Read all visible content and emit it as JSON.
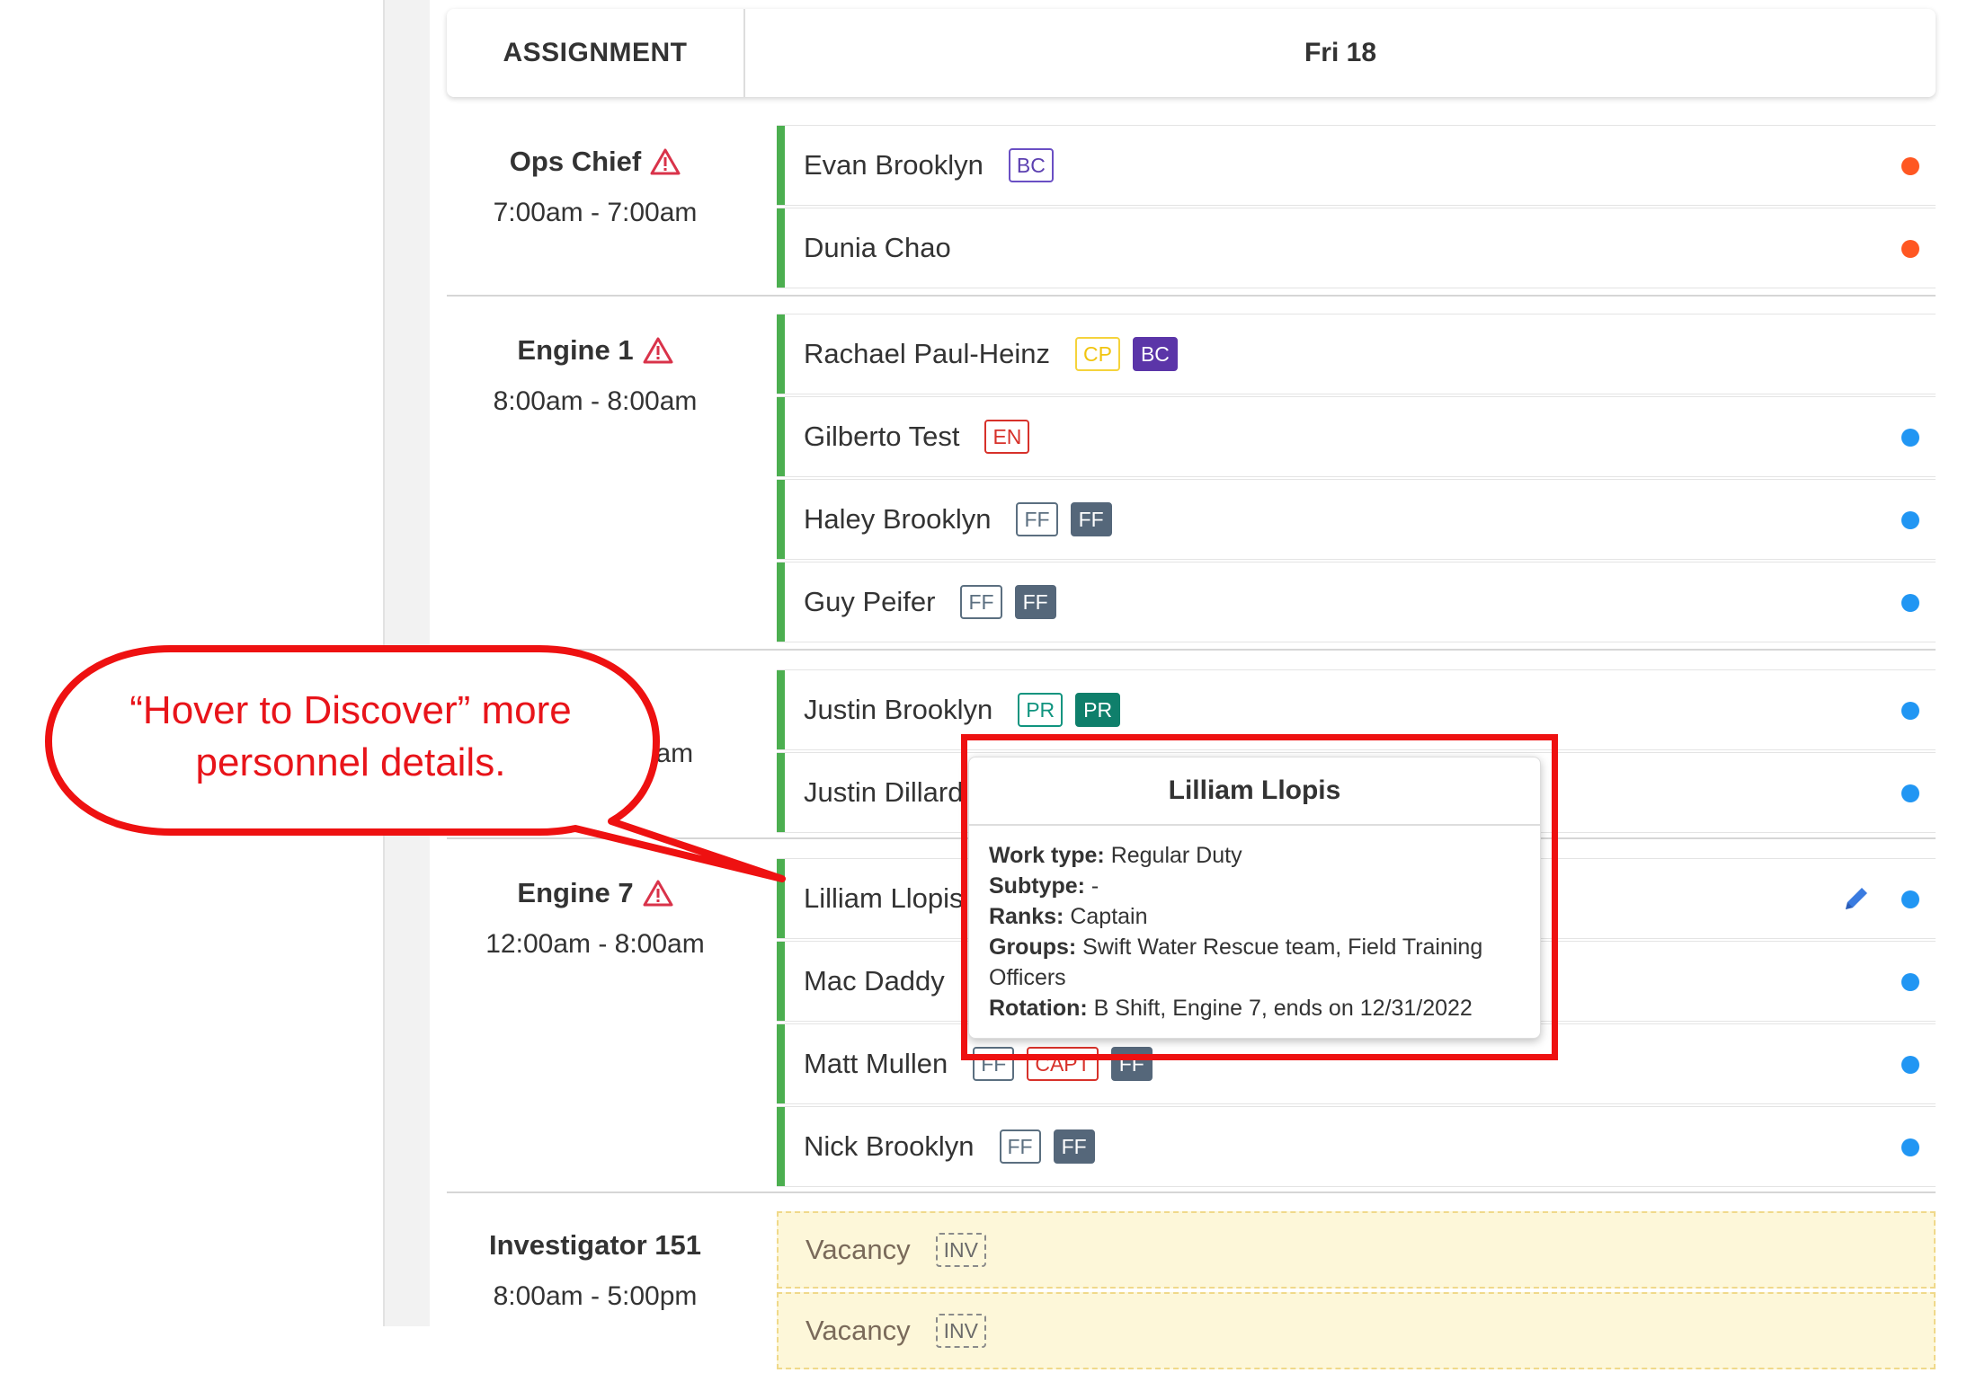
{
  "header": {
    "assignment_label": "ASSIGNMENT",
    "day_label": "Fri 18"
  },
  "colors": {
    "active_bar": "#4caf50",
    "dot_orange": "#ff5722",
    "dot_blue": "#2196f3",
    "annotation_red": "#ee1111"
  },
  "groups": [
    {
      "name": "Ops Chief",
      "time": "7:00am - 7:00am",
      "rows": [
        {
          "name": "Evan Brooklyn",
          "badges": [
            "BC"
          ],
          "status": "orange"
        },
        {
          "name": "Dunia Chao",
          "badges": [],
          "status": "orange"
        }
      ]
    },
    {
      "name": "Engine 1",
      "time": "8:00am - 8:00am",
      "rows": [
        {
          "name": "Rachael Paul-Heinz",
          "badges": [
            "CP",
            "BC"
          ],
          "status": "none"
        },
        {
          "name": "Gilberto Test",
          "badges": [
            "EN"
          ],
          "status": "blue"
        },
        {
          "name": "Haley Brooklyn",
          "badges": [
            "FF",
            "FF"
          ],
          "status": "blue"
        },
        {
          "name": "Guy Peifer",
          "badges": [
            "FF",
            "FF"
          ],
          "status": "blue"
        }
      ]
    },
    {
      "name": "",
      "time": "0am",
      "rows": [
        {
          "name": "Justin Brooklyn",
          "badges": [
            "PR",
            "PR"
          ],
          "status": "blue"
        },
        {
          "name": "Justin Dillard",
          "badges": [],
          "status": "blue"
        }
      ]
    },
    {
      "name": "Engine 7",
      "time": "12:00am - 8:00am",
      "rows": [
        {
          "name": "Lilliam Llopis",
          "badges": [],
          "status": "blue"
        },
        {
          "name": "Mac Daddy",
          "badges": [],
          "status": "blue"
        },
        {
          "name": "Matt Mullen",
          "badges": [
            "FF",
            "CAPT",
            "FF"
          ],
          "status": "blue"
        },
        {
          "name": "Nick Brooklyn",
          "badges": [
            "FF",
            "FF"
          ],
          "status": "blue"
        }
      ]
    },
    {
      "name": "Investigator 151",
      "time": "8:00am - 5:00pm",
      "vacancies": [
        {
          "name": "Vacancy",
          "badge": "INV"
        },
        {
          "name": "Vacancy",
          "badge": "INV"
        }
      ]
    }
  ],
  "tooltip": {
    "title": "Lilliam Llopis",
    "work_type_label": "Work type:",
    "work_type": "Regular Duty",
    "subtype_label": "Subtype:",
    "subtype": "-",
    "ranks_label": "Ranks:",
    "ranks": "Captain",
    "groups_label": "Groups:",
    "groups": "Swift Water Rescue team, Field Training Officers",
    "rotation_label": "Rotation:",
    "rotation": "B Shift, Engine 7, ends on 12/31/2022"
  },
  "callout": {
    "line1": "“Hover to Discover” more",
    "line2": "personnel details."
  }
}
